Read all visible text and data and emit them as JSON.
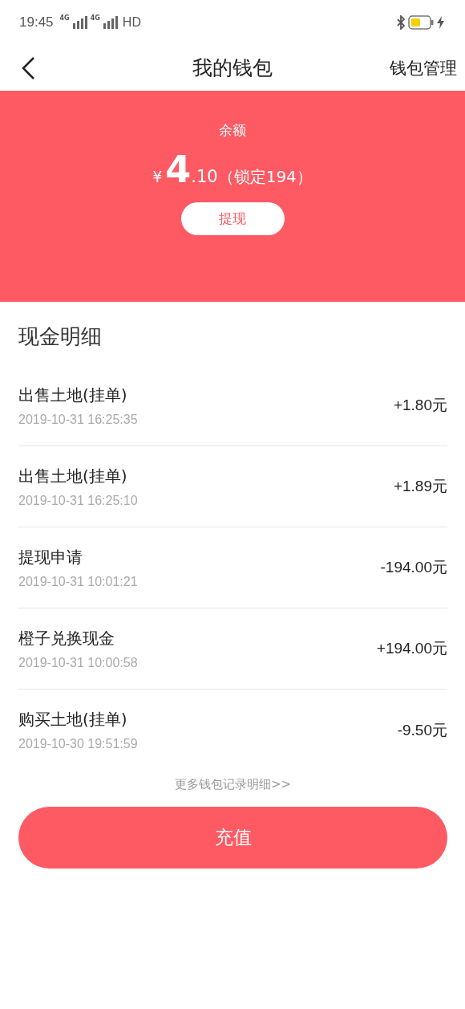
{
  "status_bar": {
    "time": "19:45",
    "network_1": "4G",
    "network_2": "4G",
    "hd": "HD"
  },
  "header": {
    "title": "我的钱包",
    "action": "钱包管理"
  },
  "balance": {
    "label": "余额",
    "currency": "¥",
    "integer": "4",
    "decimal": ".10",
    "locked": "（锁定194）",
    "withdraw_button": "提现"
  },
  "details": {
    "title": "现金明细",
    "rows": [
      {
        "name": "出售土地(挂单)",
        "time": "2019-10-31 16:25:35",
        "amount": "+1.80元"
      },
      {
        "name": "出售土地(挂单)",
        "time": "2019-10-31 16:25:10",
        "amount": "+1.89元"
      },
      {
        "name": "提现申请",
        "time": "2019-10-31 10:01:21",
        "amount": "-194.00元"
      },
      {
        "name": "橙子兑换现金",
        "time": "2019-10-31 10:00:58",
        "amount": "+194.00元"
      },
      {
        "name": "购买土地(挂单)",
        "time": "2019-10-30 19:51:59",
        "amount": "-9.50元"
      }
    ],
    "more_link": "更多钱包记录明细>>"
  },
  "recharge_button": "充值"
}
